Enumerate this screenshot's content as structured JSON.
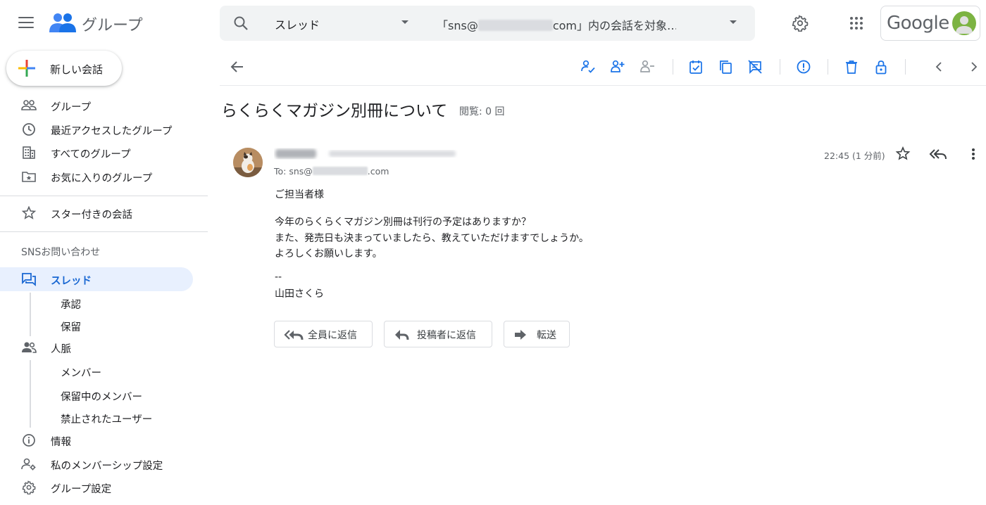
{
  "header": {
    "app_title": "グループ",
    "search": {
      "scope": "スレッド",
      "query_prefix": "「sns@",
      "query_suffix": "com」内の会話を対象…"
    },
    "brand": "Google"
  },
  "sidebar": {
    "compose_label": "新しい会話",
    "nav": [
      {
        "label": "グループ",
        "icon": "people-outline-icon"
      },
      {
        "label": "最近アクセスしたグループ",
        "icon": "clock-icon"
      },
      {
        "label": "すべてのグループ",
        "icon": "building-icon"
      },
      {
        "label": "お気に入りのグループ",
        "icon": "star-folder-icon"
      }
    ],
    "starred_label": "スター付きの会話",
    "section_title": "SNSお問い合わせ",
    "group_items": {
      "threads": "スレッド",
      "approve": "承認",
      "hold": "保留",
      "people": "人脈",
      "members": "メンバー",
      "pending_members": "保留中のメンバー",
      "banned_users": "禁止されたユーザー",
      "info": "情報",
      "my_membership": "私のメンバーシップ設定",
      "group_settings": "グループ設定"
    }
  },
  "thread": {
    "title": "らくらくマガジン別冊について",
    "views": "閲覧: 0 回",
    "message": {
      "to_prefix": "To: sns@",
      "to_suffix": ".com",
      "time": "22:45 (1 分前)",
      "body": [
        "ご担当者様",
        "今年のらくらくマガジン別冊は刊行の予定はありますか？",
        "また、発売日も決まっていましたら、教えていただけますでしょうか。",
        "よろしくお願いします。",
        "--",
        "山田さくら"
      ]
    },
    "actions": {
      "reply_all": "全員に返信",
      "reply_author": "投稿者に返信",
      "forward": "転送"
    }
  },
  "colors": {
    "accent_blue": "#1a73e8",
    "active_bg": "#e8f0fe",
    "icon_gray": "#5f6368"
  }
}
